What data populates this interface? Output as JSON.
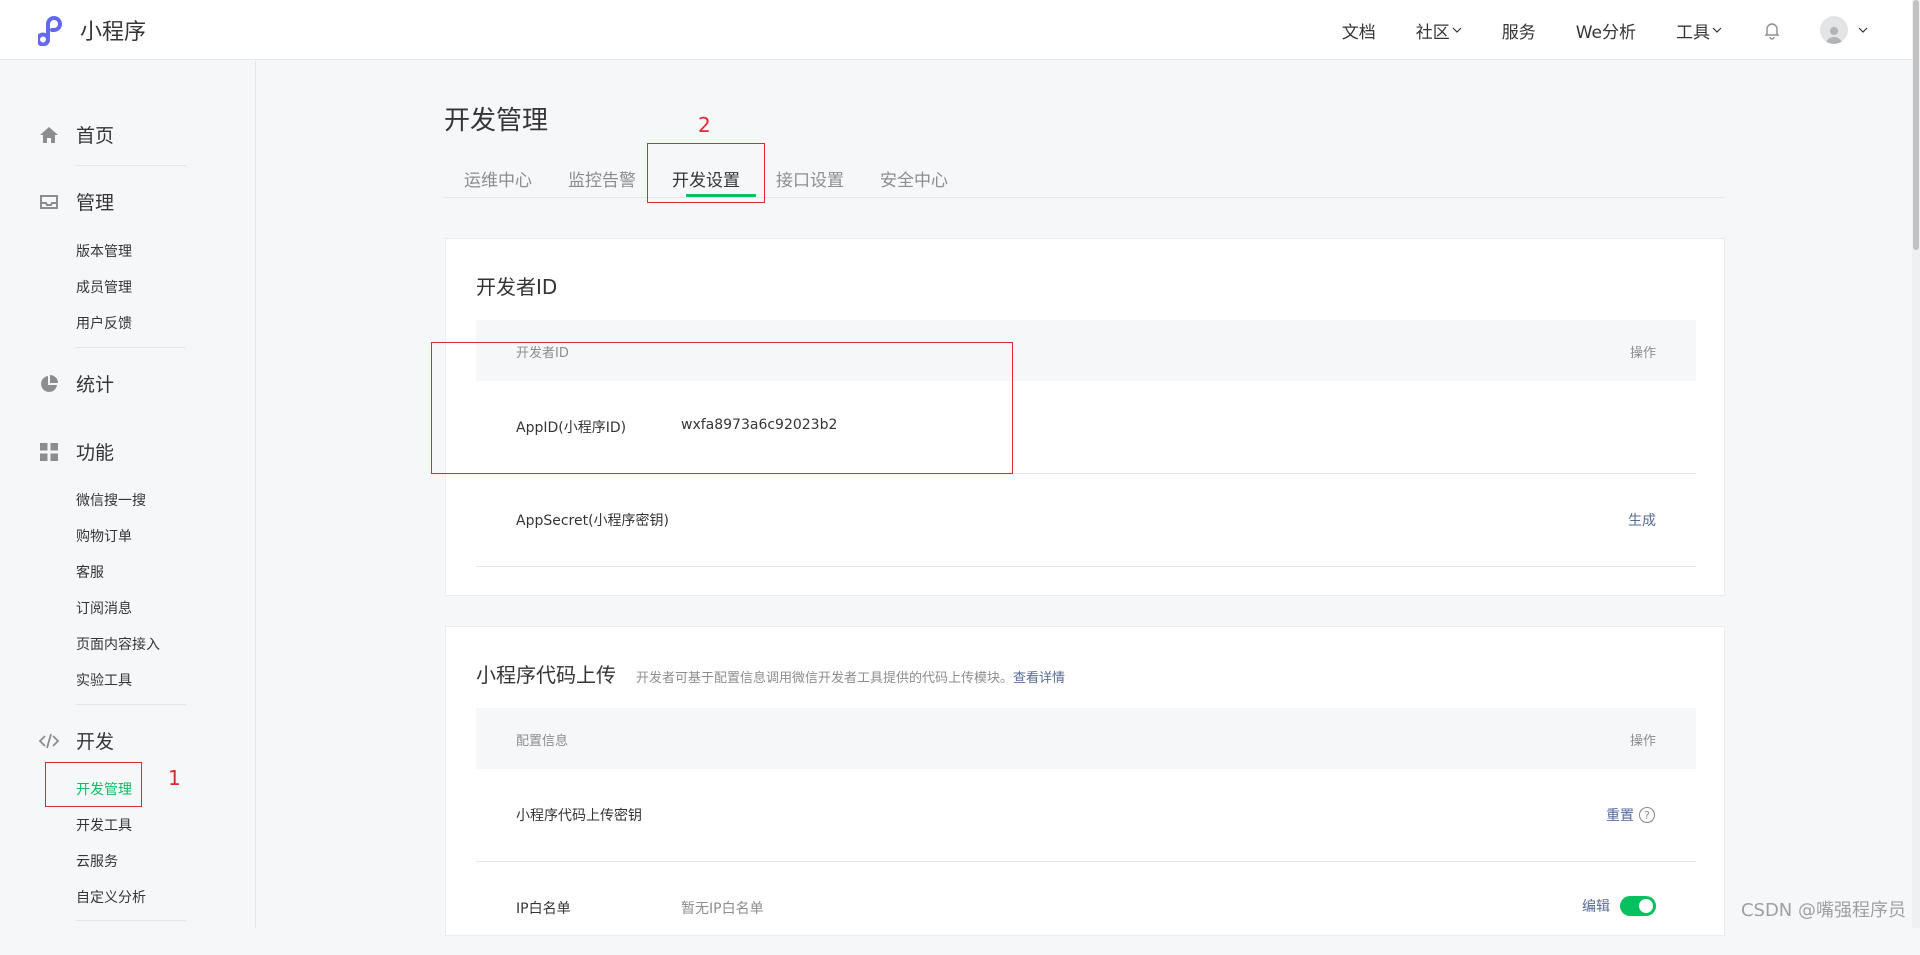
{
  "header": {
    "app_name": "小程序",
    "nav": [
      {
        "label": "文档",
        "dropdown": false
      },
      {
        "label": "社区",
        "dropdown": true
      },
      {
        "label": "服务",
        "dropdown": false
      },
      {
        "label": "We分析",
        "dropdown": false
      },
      {
        "label": "工具",
        "dropdown": true
      }
    ],
    "icons": {
      "logo": "miniprogram-logo-icon",
      "notifications": "bell-icon",
      "user": "avatar-icon"
    },
    "accent_color": "#6467f0"
  },
  "sidebar": {
    "groups": [
      {
        "label": "首页",
        "icon": "home-icon"
      },
      {
        "label": "管理",
        "icon": "inbox-icon",
        "items": [
          "版本管理",
          "成员管理",
          "用户反馈"
        ]
      },
      {
        "label": "统计",
        "icon": "pie-chart-icon"
      },
      {
        "label": "功能",
        "icon": "grid-icon",
        "items": [
          "微信搜一搜",
          "购物订单",
          "客服",
          "订阅消息",
          "页面内容接入",
          "实验工具"
        ]
      },
      {
        "label": "开发",
        "icon": "code-icon",
        "items": [
          "开发管理",
          "开发工具",
          "云服务",
          "自定义分析"
        ]
      }
    ],
    "active_item": "开发管理",
    "active_color": "#07c160"
  },
  "main": {
    "title": "开发管理",
    "tabs": [
      "运维中心",
      "监控告警",
      "开发设置",
      "接口设置",
      "安全中心"
    ],
    "active_tab": "开发设置"
  },
  "developer_id_card": {
    "title": "开发者ID",
    "header_left": "开发者ID",
    "header_right": "操作",
    "rows": [
      {
        "label": "AppID(小程序ID)",
        "value": "wxfa8973a6c92023b2",
        "action": ""
      },
      {
        "label": "AppSecret(小程序密钥)",
        "value": "",
        "action": "生成"
      }
    ]
  },
  "upload_card": {
    "title": "小程序代码上传",
    "desc": "开发者可基于配置信息调用微信开发者工具提供的代码上传模块。",
    "desc_link": "查看详情",
    "header_left": "配置信息",
    "header_right": "操作",
    "rows": [
      {
        "label": "小程序代码上传密钥",
        "value": "",
        "action": "重置"
      },
      {
        "label": "IP白名单",
        "value": "暂无IP白名单",
        "action": "编辑",
        "toggle": true
      }
    ]
  },
  "annotations": {
    "mark1": "1",
    "mark2": "2",
    "color": "#e0282e"
  },
  "watermark": "CSDN @嘴强程序员"
}
